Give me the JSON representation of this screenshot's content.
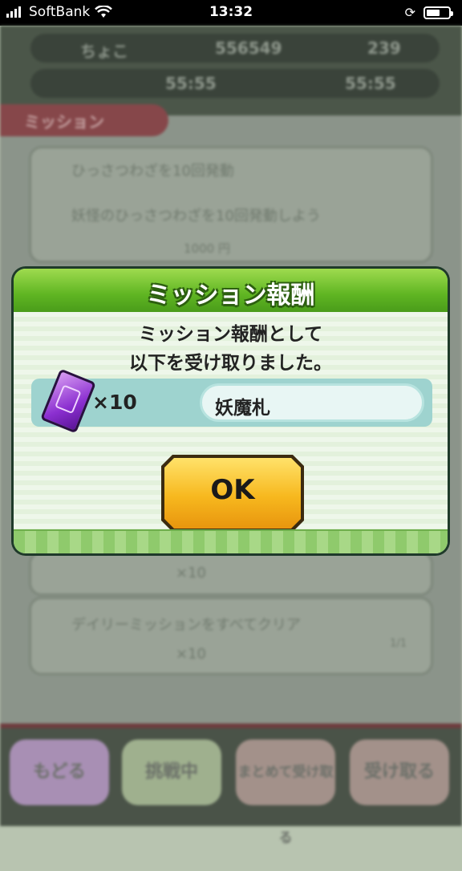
{
  "status_bar": {
    "carrier": "SoftBank",
    "time": "13:32",
    "battery_level": 0.6
  },
  "background": {
    "player_name": "ちょこ",
    "money": "556549",
    "orbs": "239",
    "timer_1": "55:55",
    "timer_2": "55:55",
    "tab_label": "ミッション",
    "mission_1_title": "ひっさつわざを10回発動",
    "mission_1_desc": "妖怪のひっさつわざを10回発動しよう",
    "mission_1_reward": "1000 円",
    "reward_qty": "×10",
    "daily_mission": "デイリーミッションをすべてクリア",
    "progress": "1/1",
    "buttons": [
      "もどる",
      "挑戦中",
      "まとめて受け取る",
      "受け取る"
    ]
  },
  "dialog": {
    "title": "ミッション報酬",
    "message_line1": "ミッション報酬として",
    "message_line2": "以下を受け取りました。",
    "item_icon": "yokai-fuda-ticket-icon",
    "quantity": "×10",
    "item_name": "妖魔札",
    "ok_label": "OK"
  },
  "colors": {
    "header_green": "#5fb522",
    "ok_yellow": "#f7b81e",
    "reward_row": "#9ed3cf"
  }
}
